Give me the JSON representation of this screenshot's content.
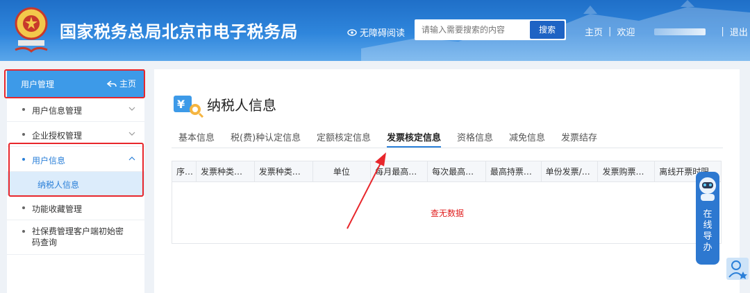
{
  "header": {
    "title": "国家税务总局北京市电子税务局",
    "accessibility_label": "无障碍阅读",
    "search_placeholder": "请输入需要搜索的内容",
    "search_button": "搜索",
    "home_link": "主页",
    "sep": "|",
    "welcome": "欢迎",
    "logout": "退出"
  },
  "sidebar": {
    "header_title": "用户管理",
    "home_label": "主页",
    "items": [
      {
        "label": "用户信息管理",
        "expanded": false
      },
      {
        "label": "企业授权管理",
        "expanded": false
      },
      {
        "label": "用户信息",
        "expanded": true
      },
      {
        "label": "纳税人信息",
        "sub": true
      },
      {
        "label": "功能收藏管理"
      },
      {
        "label": "社保费管理客户端初始密码查询"
      }
    ]
  },
  "main": {
    "title": "纳税人信息",
    "tabs": [
      "基本信息",
      "税(费)种认定信息",
      "定额核定信息",
      "发票核定信息",
      "资格信息",
      "减免信息",
      "发票结存"
    ],
    "active_tab": "发票核定信息",
    "table_headers": [
      "序号",
      "发票种类代码",
      "发票种类名称",
      "单位",
      "每月最高购...",
      "每次最高购...",
      "最高持票数量",
      "单份发票/最...",
      "发票购票方式",
      "离线开票时限"
    ],
    "empty_text": "查无数据"
  },
  "guide": {
    "label": "在线导办"
  },
  "colors": {
    "header_blue": "#2f86dc",
    "accent_blue": "#2a7fd8",
    "highlight_red": "#e8262b"
  }
}
